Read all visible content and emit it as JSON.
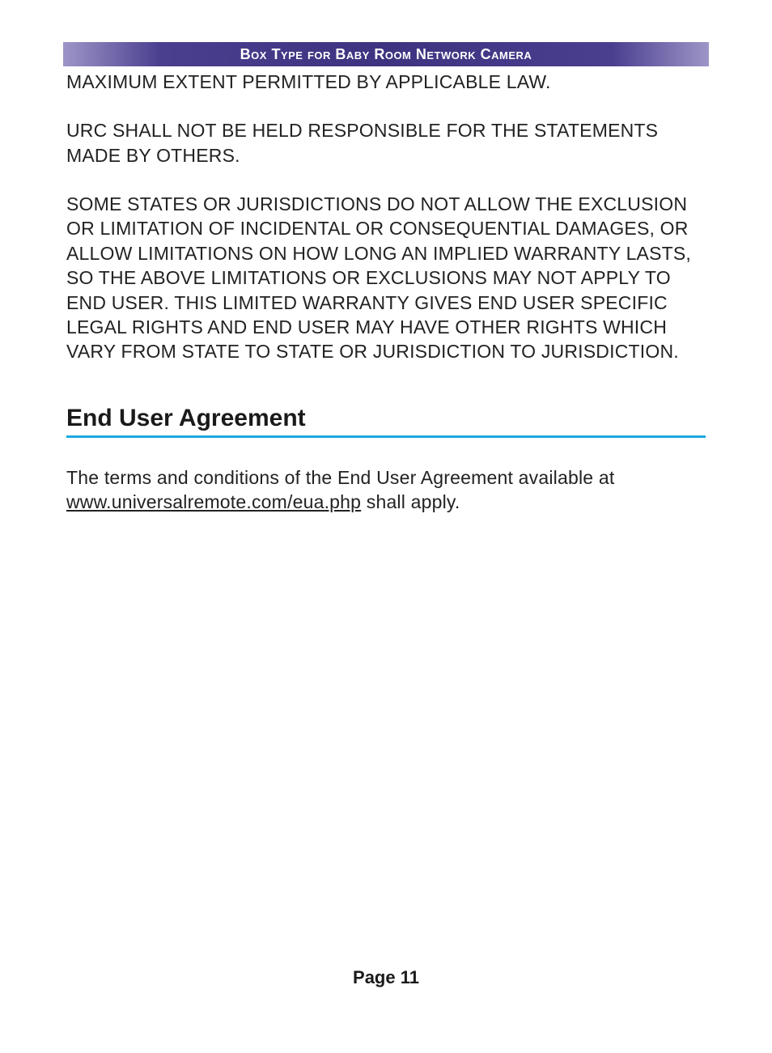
{
  "header": {
    "title": "Box Type for Baby Room Network Camera"
  },
  "body": {
    "para1": "MAXIMUM EXTENT PERMITTED BY APPLICABLE LAW.",
    "para2": "URC SHALL NOT BE HELD RESPONSIBLE FOR THE STATEMENTS MADE BY OTHERS.",
    "para3": "SOME STATES OR JURISDICTIONS DO NOT ALLOW THE EXCLUSION OR LIMITATION OF INCIDENTAL OR CONSEQUENTIAL DAMAGES, OR ALLOW LIMITATIONS ON HOW LONG AN IMPLIED WARRANTY LASTS, SO THE ABOVE LIMITATIONS OR EXCLUSIONS MAY NOT APPLY TO END USER. THIS LIMITED WARRANTY GIVES END USER SPECIFIC LEGAL RIGHTS AND END USER MAY HAVE OTHER RIGHTS WHICH VARY FROM STATE TO STATE OR JURISDICTION TO JURISDICTION."
  },
  "section": {
    "heading": "End User Agreement",
    "para_prefix": "The terms and conditions of the End User Agreement available at ",
    "link_text": "www.universalremote.com/eua.php",
    "para_suffix": "  shall apply."
  },
  "footer": {
    "page_label": "Page 11"
  }
}
